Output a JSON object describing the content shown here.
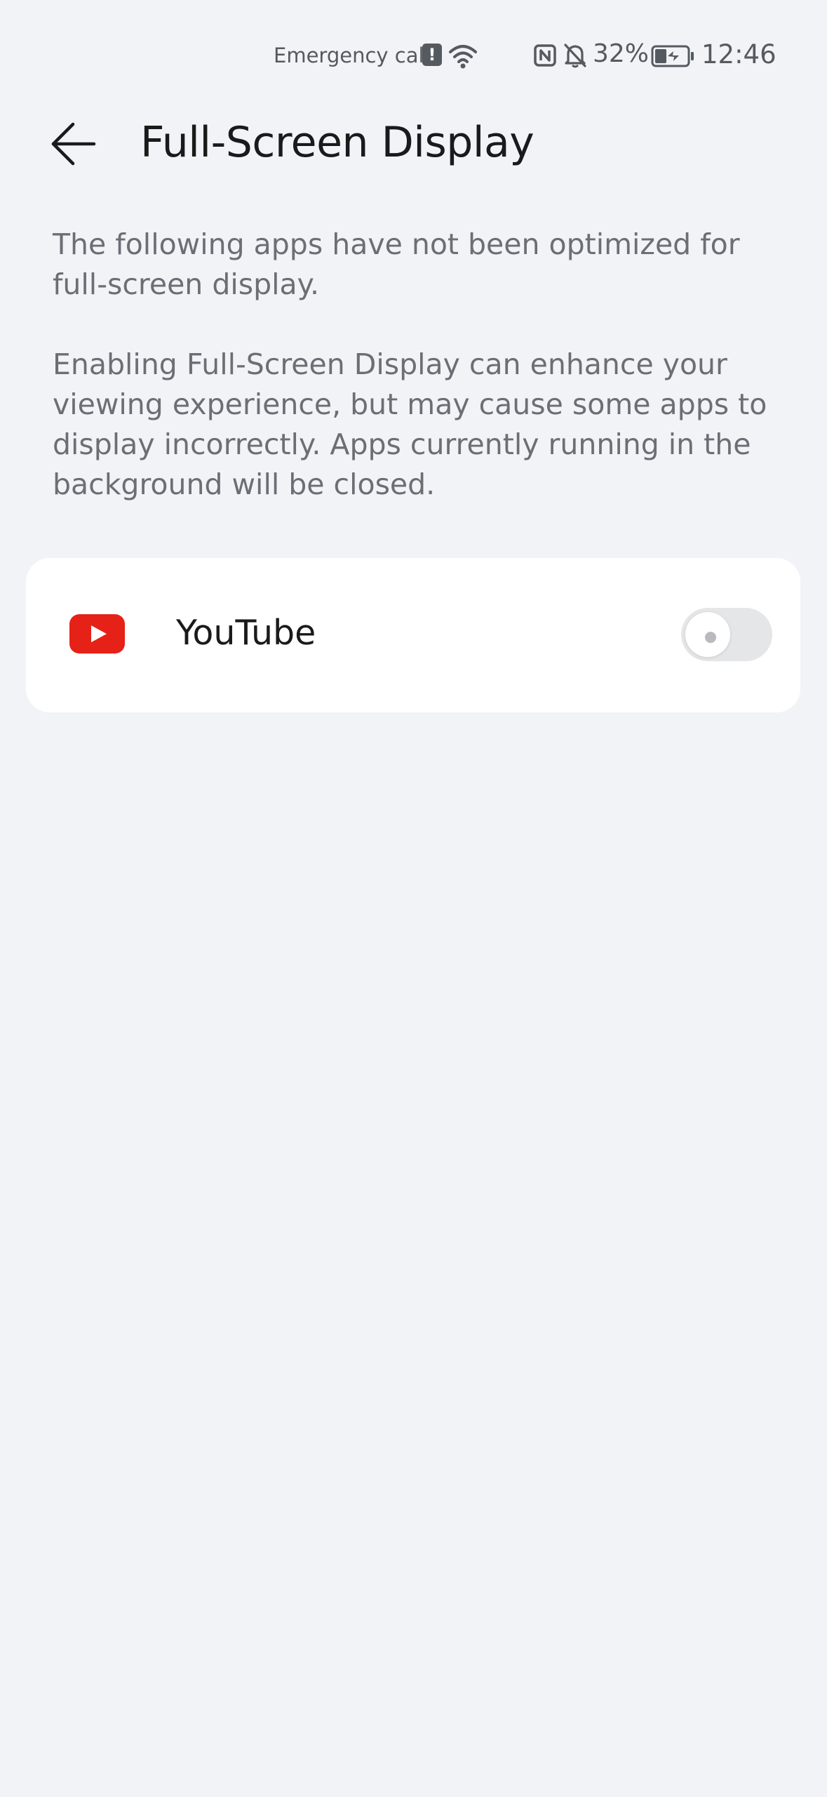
{
  "status_bar": {
    "carrier": "Emergency cal...",
    "alert_icon": "exclamation-icon",
    "battery_percent": "32%",
    "time": "12:46"
  },
  "header": {
    "back_icon": "arrow-left-icon",
    "title": "Full-Screen Display"
  },
  "description": {
    "paragraph_1": "The following apps have not been optimized for full-screen display.",
    "paragraph_2": "Enabling Full-Screen Display can enhance your viewing experience, but may cause some apps to display incorrectly. Apps currently running in the background will be closed."
  },
  "apps": [
    {
      "name": "YouTube",
      "icon": "youtube-icon",
      "full_screen_enabled": false
    }
  ],
  "colors": {
    "background": "#f1f3f7",
    "card": "#ffffff",
    "youtube_red": "#e62117",
    "toggle_off": "#e5e6e8",
    "text_primary": "#1a1a1a",
    "text_secondary": "#6b6f75"
  }
}
